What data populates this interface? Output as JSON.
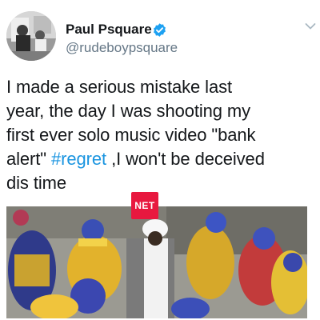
{
  "tweet": {
    "display_name": "Paul Psquare",
    "handle": "@rudeboypsquare",
    "text_lines": [
      "I made a serious mistake last",
      "year, the day I was shooting my",
      "first ever solo music video \"bank",
      "alert\"",
      ",I won't be deceived",
      "dis time"
    ],
    "hashtag": "#regret",
    "media_watermark": "NET"
  },
  "colors": {
    "hashtag": "#1b95e0",
    "verified_badge": "#1da1f2",
    "handle_text": "#657786",
    "watermark_bg": "#e8183f"
  },
  "icons": {
    "verified": "verified-badge-icon",
    "caret": "chevron-down-icon"
  }
}
